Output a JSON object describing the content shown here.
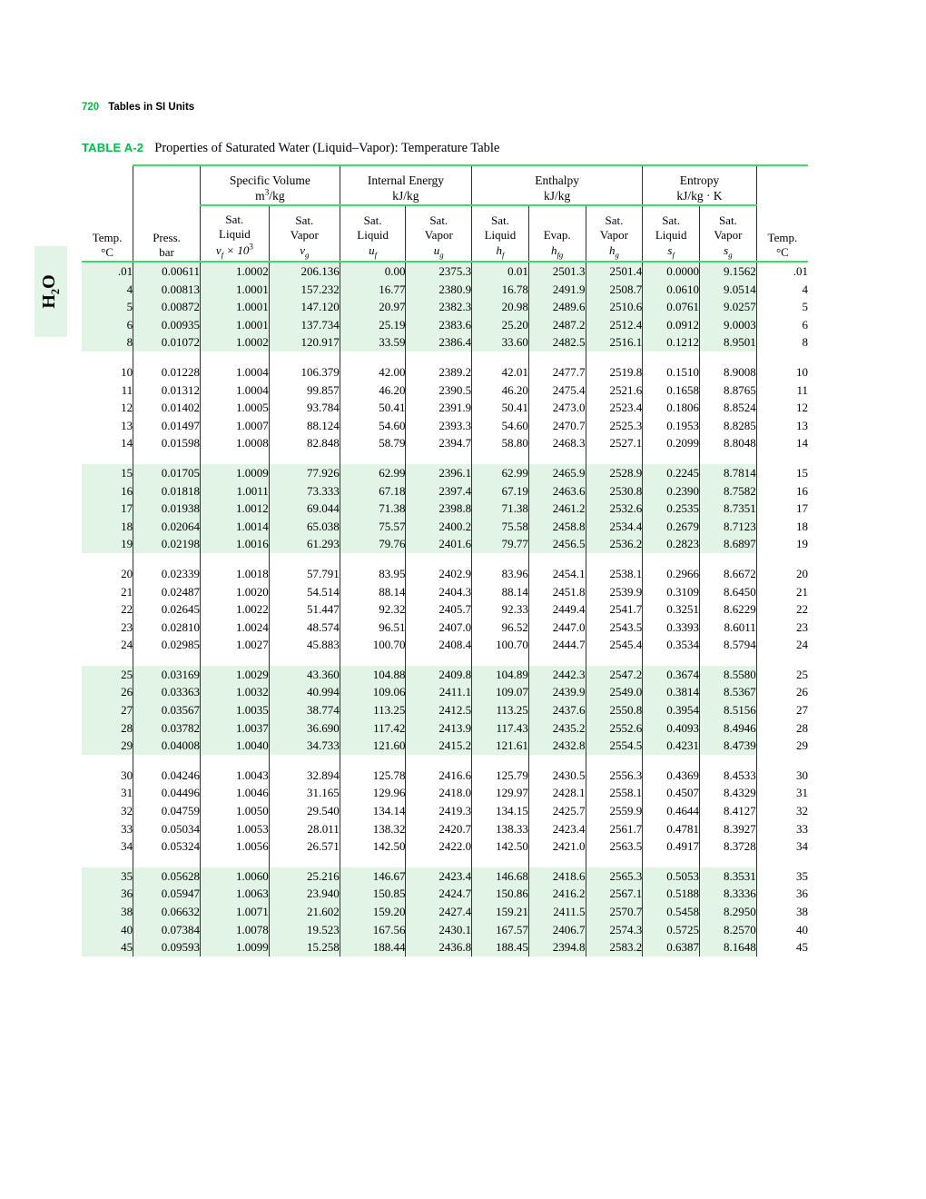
{
  "page": {
    "folio": "720",
    "running_head": "Tables in SI Units",
    "side_tab": "H2O"
  },
  "table": {
    "number": "TABLE A-2",
    "title": "Properties of Saturated Water (Liquid–Vapor): Temperature Table",
    "group_headers": [
      {
        "name": "Specific Volume",
        "units": "m3/kg",
        "span": 2
      },
      {
        "name": "Internal Energy",
        "units": "kJ/kg",
        "span": 2
      },
      {
        "name": "Enthalpy",
        "units": "kJ/kg",
        "span": 3
      },
      {
        "name": "Entropy",
        "units": "kJ/kg · K",
        "span": 2
      }
    ],
    "columns": [
      {
        "key": "temp_l",
        "l1": "Temp.",
        "l2": "°C",
        "l3": ""
      },
      {
        "key": "press",
        "l1": "Press.",
        "l2": "bar",
        "l3": ""
      },
      {
        "key": "vf",
        "l1": "Sat.",
        "l2": "Liquid",
        "l3": "vf × 10³"
      },
      {
        "key": "vg",
        "l1": "Sat.",
        "l2": "Vapor",
        "l3": "vg"
      },
      {
        "key": "uf",
        "l1": "Sat.",
        "l2": "Liquid",
        "l3": "uf"
      },
      {
        "key": "ug",
        "l1": "Sat.",
        "l2": "Vapor",
        "l3": "ug"
      },
      {
        "key": "hf",
        "l1": "Sat.",
        "l2": "Liquid",
        "l3": "hf"
      },
      {
        "key": "hfg",
        "l1": "Evap.",
        "l2": "",
        "l3": "hfg"
      },
      {
        "key": "hg",
        "l1": "Sat.",
        "l2": "Vapor",
        "l3": "hg"
      },
      {
        "key": "sf",
        "l1": "Sat.",
        "l2": "Liquid",
        "l3": "sf"
      },
      {
        "key": "sg",
        "l1": "Sat.",
        "l2": "Vapor",
        "l3": "sg"
      },
      {
        "key": "temp_r",
        "l1": "Temp.",
        "l2": "°C",
        "l3": ""
      }
    ],
    "groups": [
      {
        "shaded": true,
        "rows": [
          [
            ".01",
            "0.00611",
            "1.0002",
            "206.136",
            "0.00",
            "2375.3",
            "0.01",
            "2501.3",
            "2501.4",
            "0.0000",
            "9.1562",
            ".01"
          ],
          [
            "4",
            "0.00813",
            "1.0001",
            "157.232",
            "16.77",
            "2380.9",
            "16.78",
            "2491.9",
            "2508.7",
            "0.0610",
            "9.0514",
            "4"
          ],
          [
            "5",
            "0.00872",
            "1.0001",
            "147.120",
            "20.97",
            "2382.3",
            "20.98",
            "2489.6",
            "2510.6",
            "0.0761",
            "9.0257",
            "5"
          ],
          [
            "6",
            "0.00935",
            "1.0001",
            "137.734",
            "25.19",
            "2383.6",
            "25.20",
            "2487.2",
            "2512.4",
            "0.0912",
            "9.0003",
            "6"
          ],
          [
            "8",
            "0.01072",
            "1.0002",
            "120.917",
            "33.59",
            "2386.4",
            "33.60",
            "2482.5",
            "2516.1",
            "0.1212",
            "8.9501",
            "8"
          ]
        ]
      },
      {
        "shaded": false,
        "rows": [
          [
            "10",
            "0.01228",
            "1.0004",
            "106.379",
            "42.00",
            "2389.2",
            "42.01",
            "2477.7",
            "2519.8",
            "0.1510",
            "8.9008",
            "10"
          ],
          [
            "11",
            "0.01312",
            "1.0004",
            "99.857",
            "46.20",
            "2390.5",
            "46.20",
            "2475.4",
            "2521.6",
            "0.1658",
            "8.8765",
            "11"
          ],
          [
            "12",
            "0.01402",
            "1.0005",
            "93.784",
            "50.41",
            "2391.9",
            "50.41",
            "2473.0",
            "2523.4",
            "0.1806",
            "8.8524",
            "12"
          ],
          [
            "13",
            "0.01497",
            "1.0007",
            "88.124",
            "54.60",
            "2393.3",
            "54.60",
            "2470.7",
            "2525.3",
            "0.1953",
            "8.8285",
            "13"
          ],
          [
            "14",
            "0.01598",
            "1.0008",
            "82.848",
            "58.79",
            "2394.7",
            "58.80",
            "2468.3",
            "2527.1",
            "0.2099",
            "8.8048",
            "14"
          ]
        ]
      },
      {
        "shaded": true,
        "rows": [
          [
            "15",
            "0.01705",
            "1.0009",
            "77.926",
            "62.99",
            "2396.1",
            "62.99",
            "2465.9",
            "2528.9",
            "0.2245",
            "8.7814",
            "15"
          ],
          [
            "16",
            "0.01818",
            "1.0011",
            "73.333",
            "67.18",
            "2397.4",
            "67.19",
            "2463.6",
            "2530.8",
            "0.2390",
            "8.7582",
            "16"
          ],
          [
            "17",
            "0.01938",
            "1.0012",
            "69.044",
            "71.38",
            "2398.8",
            "71.38",
            "2461.2",
            "2532.6",
            "0.2535",
            "8.7351",
            "17"
          ],
          [
            "18",
            "0.02064",
            "1.0014",
            "65.038",
            "75.57",
            "2400.2",
            "75.58",
            "2458.8",
            "2534.4",
            "0.2679",
            "8.7123",
            "18"
          ],
          [
            "19",
            "0.02198",
            "1.0016",
            "61.293",
            "79.76",
            "2401.6",
            "79.77",
            "2456.5",
            "2536.2",
            "0.2823",
            "8.6897",
            "19"
          ]
        ]
      },
      {
        "shaded": false,
        "rows": [
          [
            "20",
            "0.02339",
            "1.0018",
            "57.791",
            "83.95",
            "2402.9",
            "83.96",
            "2454.1",
            "2538.1",
            "0.2966",
            "8.6672",
            "20"
          ],
          [
            "21",
            "0.02487",
            "1.0020",
            "54.514",
            "88.14",
            "2404.3",
            "88.14",
            "2451.8",
            "2539.9",
            "0.3109",
            "8.6450",
            "21"
          ],
          [
            "22",
            "0.02645",
            "1.0022",
            "51.447",
            "92.32",
            "2405.7",
            "92.33",
            "2449.4",
            "2541.7",
            "0.3251",
            "8.6229",
            "22"
          ],
          [
            "23",
            "0.02810",
            "1.0024",
            "48.574",
            "96.51",
            "2407.0",
            "96.52",
            "2447.0",
            "2543.5",
            "0.3393",
            "8.6011",
            "23"
          ],
          [
            "24",
            "0.02985",
            "1.0027",
            "45.883",
            "100.70",
            "2408.4",
            "100.70",
            "2444.7",
            "2545.4",
            "0.3534",
            "8.5794",
            "24"
          ]
        ]
      },
      {
        "shaded": true,
        "rows": [
          [
            "25",
            "0.03169",
            "1.0029",
            "43.360",
            "104.88",
            "2409.8",
            "104.89",
            "2442.3",
            "2547.2",
            "0.3674",
            "8.5580",
            "25"
          ],
          [
            "26",
            "0.03363",
            "1.0032",
            "40.994",
            "109.06",
            "2411.1",
            "109.07",
            "2439.9",
            "2549.0",
            "0.3814",
            "8.5367",
            "26"
          ],
          [
            "27",
            "0.03567",
            "1.0035",
            "38.774",
            "113.25",
            "2412.5",
            "113.25",
            "2437.6",
            "2550.8",
            "0.3954",
            "8.5156",
            "27"
          ],
          [
            "28",
            "0.03782",
            "1.0037",
            "36.690",
            "117.42",
            "2413.9",
            "117.43",
            "2435.2",
            "2552.6",
            "0.4093",
            "8.4946",
            "28"
          ],
          [
            "29",
            "0.04008",
            "1.0040",
            "34.733",
            "121.60",
            "2415.2",
            "121.61",
            "2432.8",
            "2554.5",
            "0.4231",
            "8.4739",
            "29"
          ]
        ]
      },
      {
        "shaded": false,
        "rows": [
          [
            "30",
            "0.04246",
            "1.0043",
            "32.894",
            "125.78",
            "2416.6",
            "125.79",
            "2430.5",
            "2556.3",
            "0.4369",
            "8.4533",
            "30"
          ],
          [
            "31",
            "0.04496",
            "1.0046",
            "31.165",
            "129.96",
            "2418.0",
            "129.97",
            "2428.1",
            "2558.1",
            "0.4507",
            "8.4329",
            "31"
          ],
          [
            "32",
            "0.04759",
            "1.0050",
            "29.540",
            "134.14",
            "2419.3",
            "134.15",
            "2425.7",
            "2559.9",
            "0.4644",
            "8.4127",
            "32"
          ],
          [
            "33",
            "0.05034",
            "1.0053",
            "28.011",
            "138.32",
            "2420.7",
            "138.33",
            "2423.4",
            "2561.7",
            "0.4781",
            "8.3927",
            "33"
          ],
          [
            "34",
            "0.05324",
            "1.0056",
            "26.571",
            "142.50",
            "2422.0",
            "142.50",
            "2421.0",
            "2563.5",
            "0.4917",
            "8.3728",
            "34"
          ]
        ]
      },
      {
        "shaded": true,
        "rows": [
          [
            "35",
            "0.05628",
            "1.0060",
            "25.216",
            "146.67",
            "2423.4",
            "146.68",
            "2418.6",
            "2565.3",
            "0.5053",
            "8.3531",
            "35"
          ],
          [
            "36",
            "0.05947",
            "1.0063",
            "23.940",
            "150.85",
            "2424.7",
            "150.86",
            "2416.2",
            "2567.1",
            "0.5188",
            "8.3336",
            "36"
          ],
          [
            "38",
            "0.06632",
            "1.0071",
            "21.602",
            "159.20",
            "2427.4",
            "159.21",
            "2411.5",
            "2570.7",
            "0.5458",
            "8.2950",
            "38"
          ],
          [
            "40",
            "0.07384",
            "1.0078",
            "19.523",
            "167.56",
            "2430.1",
            "167.57",
            "2406.7",
            "2574.3",
            "0.5725",
            "8.2570",
            "40"
          ],
          [
            "45",
            "0.09593",
            "1.0099",
            "15.258",
            "188.44",
            "2436.8",
            "188.45",
            "2394.8",
            "2583.2",
            "0.6387",
            "8.1648",
            "45"
          ]
        ]
      }
    ]
  },
  "colors": {
    "accent_green": "#00bb44",
    "rule_green": "#3ddc6a",
    "shade_green": "#e2f4e6"
  }
}
